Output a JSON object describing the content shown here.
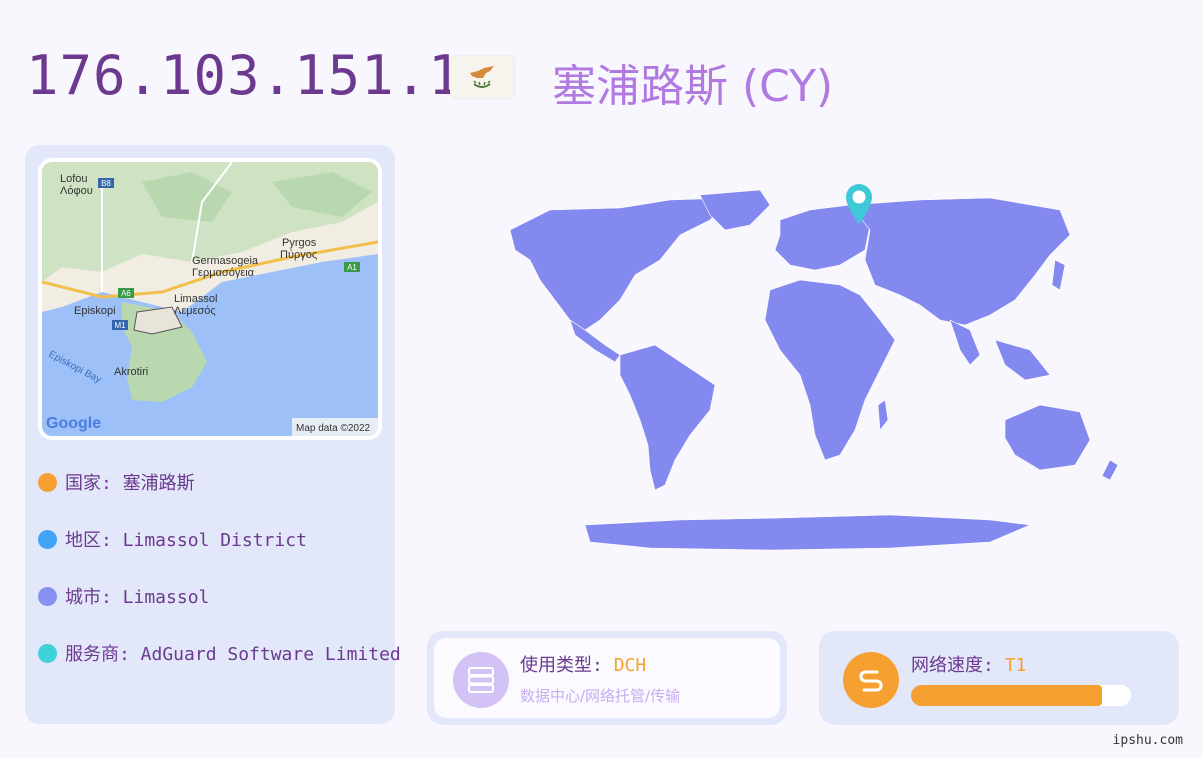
{
  "header": {
    "ip": "176.103.151.1",
    "country_title": "塞浦路斯 (CY)"
  },
  "map": {
    "labels": {
      "lofou": "Lofou",
      "lofou_gr": "Λόφου",
      "b8": "B8",
      "pyrgos": "Pyrgos",
      "pyrgos_gr": "Πύργος",
      "germasogeia": "Germasogeia",
      "germasogeia_gr": "Γερμασόγεια",
      "a1": "A1",
      "a6": "A6",
      "limassol": "Limassol",
      "limassol_gr": "Λεμεσός",
      "episkopi": "Episkopi",
      "m1": "M1",
      "episkopi_bay": "Episkopi Bay",
      "akrotiri": "Akrotiri",
      "google": "Google",
      "attribution": "Map data ©2022"
    }
  },
  "info": {
    "country": "国家: 塞浦路斯",
    "region": "地区: Limassol District",
    "city": "城市: Limassol",
    "isp": "服务商: AdGuard Software Limited"
  },
  "colors": {
    "country_dot": "#f5a030",
    "region_dot": "#3fa5f5",
    "city_dot": "#8890f0",
    "isp_dot": "#3ed2d8",
    "world_land": "#8389ef",
    "pin": "#3ec8d8",
    "speed_accent": "#f5a030",
    "type_icon_bg": "#d3c2f6"
  },
  "usage": {
    "label": "使用类型: ",
    "value": "DCH",
    "description": "数据中心/网络托管/传输",
    "icon": "server-icon"
  },
  "speed": {
    "label": "网络速度: ",
    "value": "T1",
    "progress": 0.87,
    "icon": "speed-s-icon"
  },
  "watermark": "ipshu.com"
}
